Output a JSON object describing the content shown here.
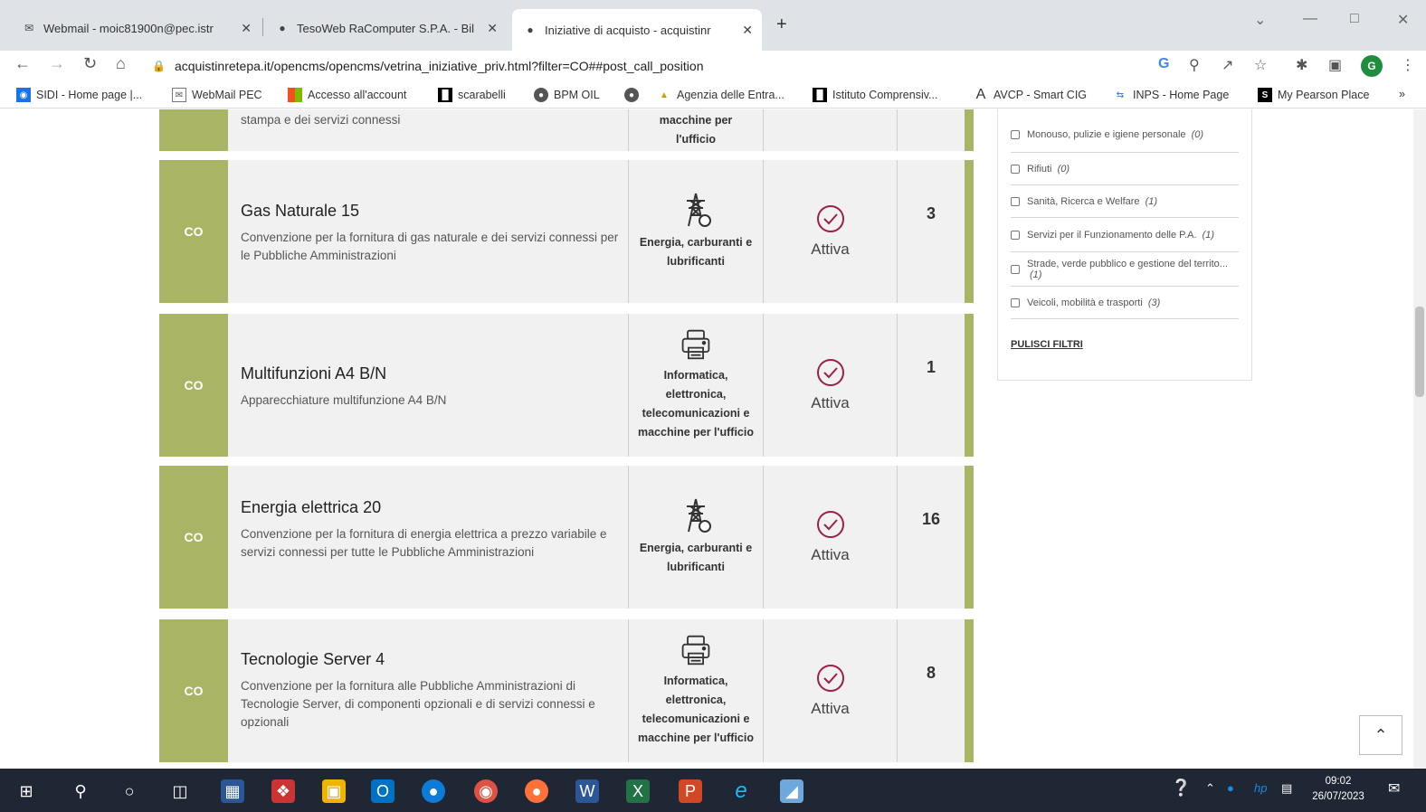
{
  "browser": {
    "tabs": [
      {
        "title": "Webmail - moic81900n@pec.istr",
        "icon": "mail-icon"
      },
      {
        "title": "TesoWeb RaComputer S.P.A. - Bil",
        "icon": "globe-icon"
      },
      {
        "title": "Iniziative di acquisto - acquistinr",
        "icon": "globe-icon"
      }
    ],
    "url": "acquistinretepa.it/opencms/opencms/vetrina_iniziative_priv.html?filter=CO##post_call_position",
    "profile_initial": "G",
    "bookmarks": [
      "SIDI - Home page |...",
      "WebMail PEC",
      "Accesso all'account",
      "scarabelli",
      "BPM OIL",
      "",
      "Agenzia delle Entra...",
      "Istituto Comprensiv...",
      "AVCP - Smart CIG",
      "INPS - Home Page",
      "My Pearson Place"
    ],
    "bookmarks_more": "»"
  },
  "partial_card": {
    "desc_tail": "stampa e dei servizi connessi",
    "category": "macchine per l'ufficio"
  },
  "cards": [
    {
      "badge": "CO",
      "title": "Gas Naturale 15",
      "description": "Convenzione per la fornitura di gas naturale e dei servizi connessi per le Pubbliche Amministrazioni",
      "category_icon": "power-tower-icon",
      "category": "Energia, carburanti e lubrificanti",
      "status": "Attiva",
      "count": "3"
    },
    {
      "badge": "CO",
      "title": "Multifunzioni A4 B/N",
      "description": "Apparecchiature multifunzione A4 B/N",
      "category_icon": "printer-icon",
      "category": "Informatica, elettronica, telecomunicazioni e macchine per l'ufficio",
      "status": "Attiva",
      "count": "1"
    },
    {
      "badge": "CO",
      "title": "Energia elettrica 20",
      "description": "Convenzione per la fornitura di energia elettrica a prezzo variabile e servizi connessi per tutte le Pubbliche Amministrazioni",
      "category_icon": "power-tower-icon",
      "category": "Energia, carburanti e lubrificanti",
      "status": "Attiva",
      "count": "16"
    },
    {
      "badge": "CO",
      "title": "Tecnologie Server 4",
      "description": "Convenzione per la fornitura alle Pubbliche Amministrazioni di Tecnologie Server, di componenti opzionali e di servizi connessi e opzionali",
      "category_icon": "printer-icon",
      "category": "Informatica, elettronica, telecomunicazioni e macchine per l'ufficio",
      "status": "Attiva",
      "count": "8"
    }
  ],
  "filters": {
    "items": [
      {
        "label": "Monouso, pulizie e igiene personale",
        "count": "(0)"
      },
      {
        "label": "Rifiuti",
        "count": "(0)"
      },
      {
        "label": "Sanità, Ricerca e Welfare",
        "count": "(1)"
      },
      {
        "label": "Servizi per il Funzionamento delle P.A.",
        "count": "(1)"
      },
      {
        "label": "Strade, verde pubblico e gestione del territo...",
        "count": "(1)"
      },
      {
        "label": "Veicoli, mobilità e trasporti",
        "count": "(3)"
      }
    ],
    "clear_label": "PULISCI FILTRI"
  },
  "scroll_top_label": "⌃",
  "taskbar": {
    "time": "09:02",
    "date": "26/07/2023"
  },
  "colors": {
    "accent_green": "#a9b465",
    "taskbar": "#1f2634"
  }
}
